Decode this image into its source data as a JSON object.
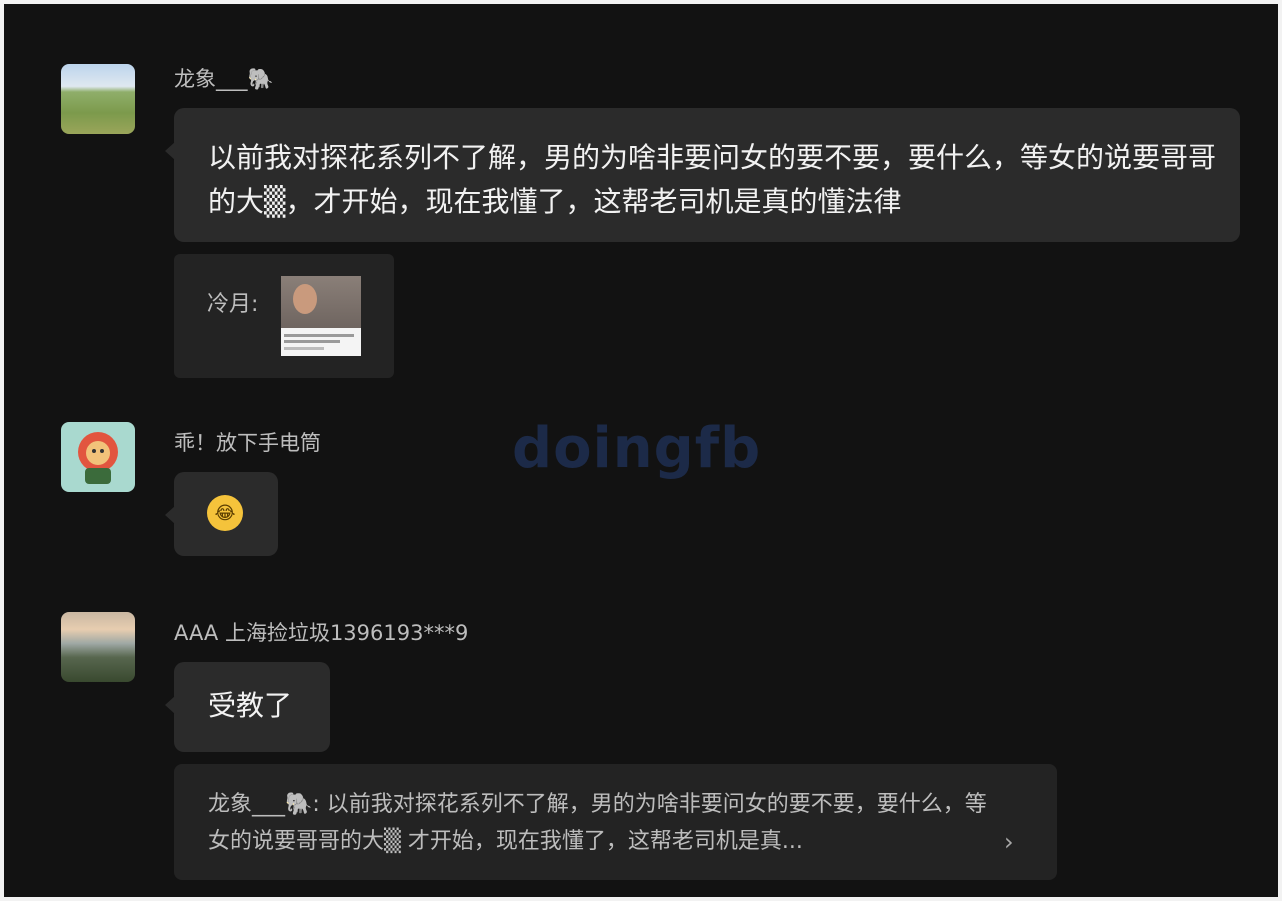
{
  "messages": [
    {
      "sender": "龙象___🐘",
      "text": "以前我对探花系列不了解，男的为啥非要问女的要不要，要什么，等女的说要哥哥的大▒，才开始，现在我懂了，这帮老司机是真的懂法律"
    },
    {
      "reply_label": "冷月:"
    },
    {
      "sender": "乖！放下手电筒",
      "emoji": "😂"
    },
    {
      "sender": "AAA 上海捡垃圾1396193***9",
      "text": "受教了"
    }
  ],
  "quote": {
    "text": "龙象___🐘: 以前我对探花系列不了解，男的为啥非要问女的要不要，要什么，等女的说要哥哥的大▒ 才开始，现在我懂了，这帮老司机是真...",
    "chevron": "›"
  },
  "watermark": "doingfb",
  "colors": {
    "background": "#121212",
    "bubble": "#2b2b2b",
    "quote_bg": "#232323",
    "sender_text": "#bdbdbd",
    "message_text": "#f2f2f2"
  },
  "icons": [
    "avatar-landscape-icon",
    "avatar-lion-icon",
    "avatar-mountain-icon",
    "crying-laughing-emoji-icon",
    "chevron-right-icon"
  ]
}
